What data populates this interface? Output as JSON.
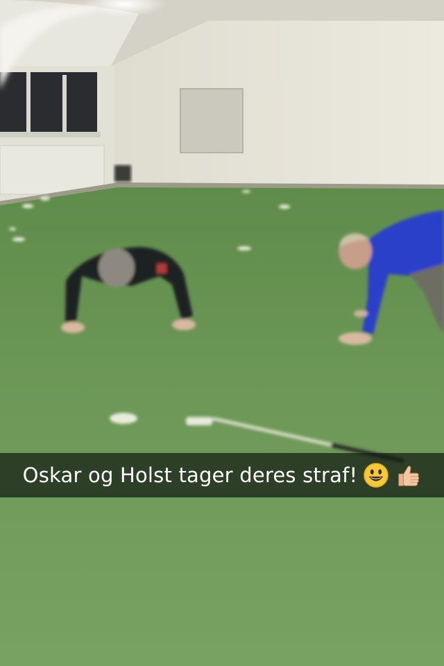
{
  "snap": {
    "caption": "Oskar og Holst tager deres straf!",
    "emoji": [
      "smiley-icon",
      "thumbs-up-icon"
    ]
  },
  "colors": {
    "turf": "#6f9a5a",
    "wall": "#e6e4d6",
    "ceiling": "#dcdad0",
    "shirt_blue": "#2a3fc8",
    "caption_bar": "#1c241c"
  }
}
